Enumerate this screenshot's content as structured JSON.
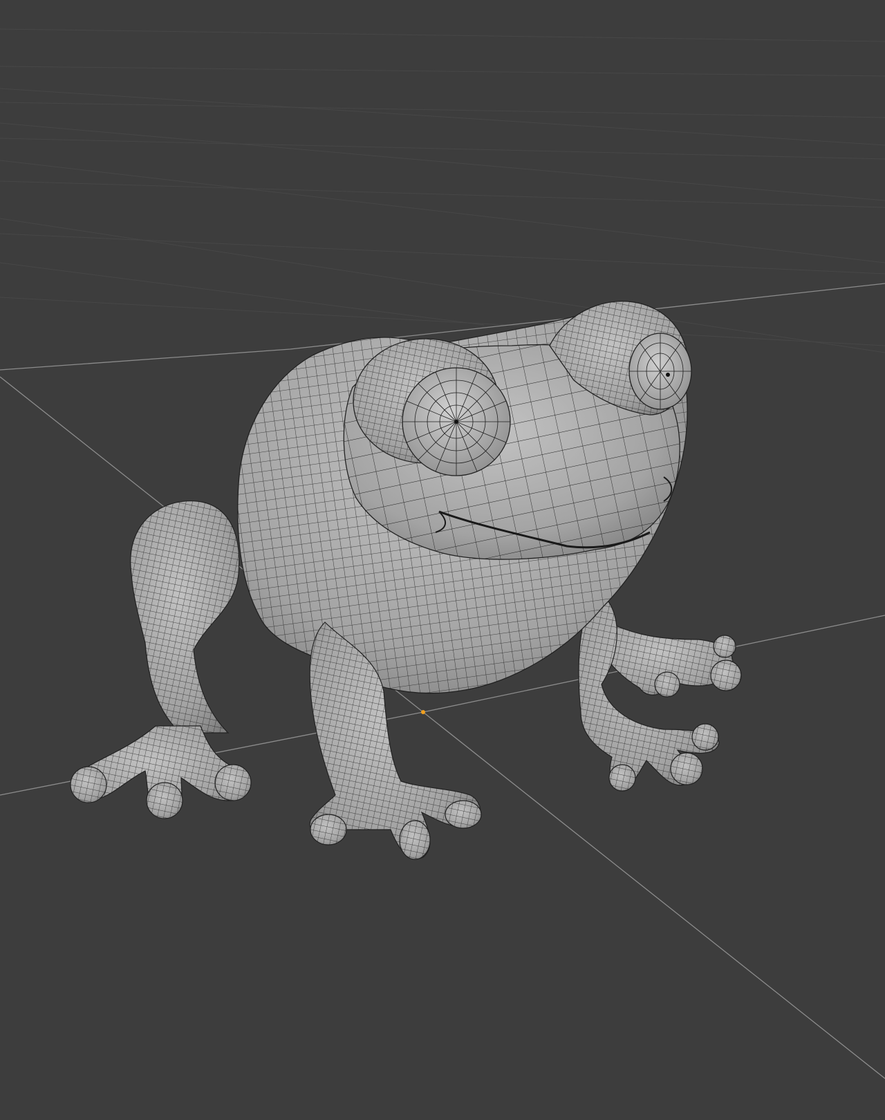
{
  "viewport": {
    "background_color": "#3d3d3d",
    "grid_color": "#4a4a4a",
    "axis_line_color": "#8e8e8e",
    "origin_marker_color": "#f0a020",
    "mesh_fill_color": "#a8a8a8",
    "mesh_wire_color": "#1a1a1a",
    "object_kind": "subdivided frog mesh with wireframe overlay"
  }
}
